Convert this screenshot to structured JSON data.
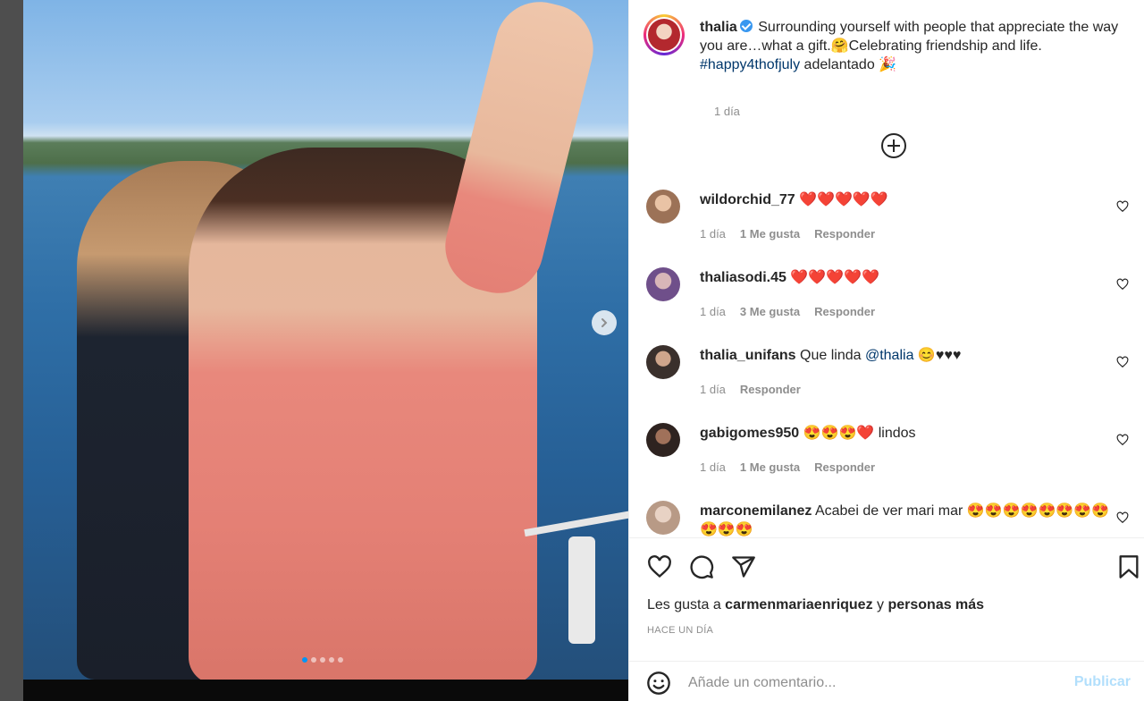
{
  "post": {
    "caption": {
      "username": "thalia",
      "text_part1": "Surrounding yourself with people that appreciate the way you are…what a gift.🤗Celebrating friendship and life. ",
      "hashtag": "#happy4thofjuly",
      "text_part2": " adelantado 🎉",
      "time": "1 día"
    },
    "media": {
      "carousel_dots": 5,
      "active_index": 0
    }
  },
  "comments": [
    {
      "username": "wildorchid_77",
      "text": "❤️❤️❤️❤️❤️",
      "time": "1 día",
      "likes": "1 Me gusta",
      "reply": "Responder",
      "avatar_color": "#c59f83"
    },
    {
      "username": "thaliasodi.45",
      "text": "❤️❤️❤️❤️❤️",
      "time": "1 día",
      "likes": "3 Me gusta",
      "reply": "Responder",
      "avatar_color": "#7b5a8a"
    },
    {
      "username": "thalia_unifans",
      "text": "Que linda ",
      "mention": "@thalia",
      "text_after": " 😊♥♥♥",
      "time": "1 día",
      "likes": "",
      "reply": "Responder",
      "avatar_color": "#5a4a44"
    },
    {
      "username": "gabigomes950",
      "text": "😍😍😍❤️ lindos",
      "time": "1 día",
      "likes": "1 Me gusta",
      "reply": "Responder",
      "avatar_color": "#3e2e2a"
    },
    {
      "username": "marconemilanez",
      "text": "Acabei de ver mari mar 😍😍😍😍😍😍😍😍😍😍😍",
      "time": "",
      "likes": "",
      "reply": "",
      "avatar_color": "#b89a86"
    }
  ],
  "actions": {
    "likes_prefix": "Les gusta a ",
    "likes_user": "carmenmariaenriquez",
    "likes_mid": " y ",
    "likes_suffix": "personas más",
    "post_time": "Hace un día"
  },
  "add_comment": {
    "placeholder": "Añade un comentario...",
    "publish_label": "Publicar"
  }
}
